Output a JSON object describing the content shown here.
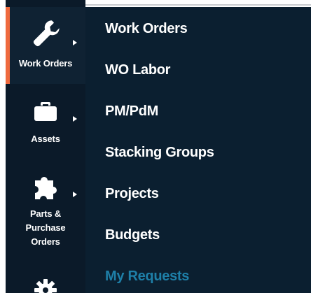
{
  "sidebar": {
    "accent_color": "#ef6a3e",
    "items": [
      {
        "label": "Work Orders",
        "icon": "wrench-icon",
        "active": true
      },
      {
        "label": "Assets",
        "icon": "briefcase-icon",
        "active": false
      },
      {
        "label": "Parts &\nPurchase\nOrders",
        "icon": "puzzle-icon",
        "active": false
      },
      {
        "label": "",
        "icon": "gear-icon",
        "active": false
      }
    ]
  },
  "submenu": {
    "items": [
      {
        "label": "Work Orders"
      },
      {
        "label": "WO Labor"
      },
      {
        "label": "PM/PdM"
      },
      {
        "label": "Stacking Groups"
      },
      {
        "label": "Projects"
      },
      {
        "label": "Budgets"
      },
      {
        "label": "My Requests",
        "color": "#1e7fa8"
      }
    ]
  }
}
